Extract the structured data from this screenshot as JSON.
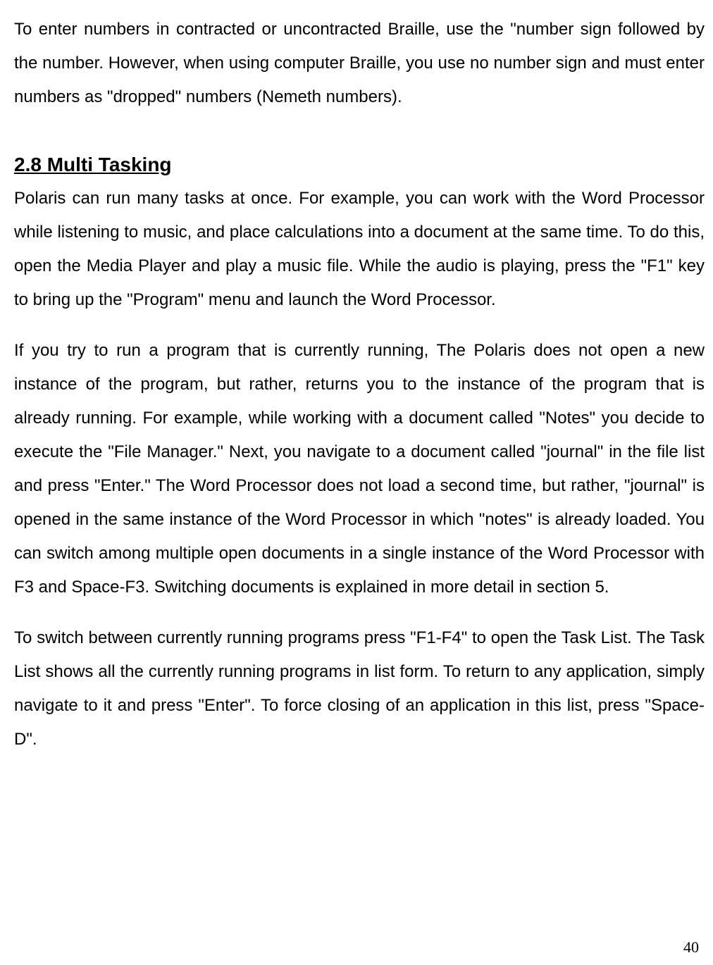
{
  "paragraphs": {
    "intro": "To enter numbers in contracted or uncontracted Braille, use the \"number sign followed by the number. However, when using computer Braille, you use no number sign and must enter numbers as \"dropped\" numbers (Nemeth numbers).",
    "heading": "2.8 Multi Tasking",
    "p1": "Polaris can run many tasks at once. For example, you can work with the Word Processor while listening to music, and place calculations into a document at the same time. To do this, open the Media Player and play a music file. While the audio is playing, press the \"F1\" key to bring up the \"Program\" menu and launch the Word Processor.",
    "p2": "If you try to run a program that is currently running, The Polaris does not open a new instance of the program, but rather, returns you to the instance of the program that is already running. For example, while working with a document called \"Notes\" you decide to execute the \"File Manager.\" Next, you navigate to a document called \"journal\" in the file list and press \"Enter.\" The Word Processor does not load a second time, but rather, \"journal\" is opened in the same instance of the Word Processor in which \"notes\" is already loaded. You can switch among multiple open documents in a single instance of the Word Processor with F3 and Space-F3. Switching documents is explained in more detail in section 5.",
    "p3": "To switch between currently running programs press \"F1-F4\" to open the Task List. The Task List shows all the currently running programs in list form. To return to any application, simply navigate to it and press \"Enter\". To force closing of an application in this list, press \"Space-D\".",
    "pageNumber": "40"
  }
}
